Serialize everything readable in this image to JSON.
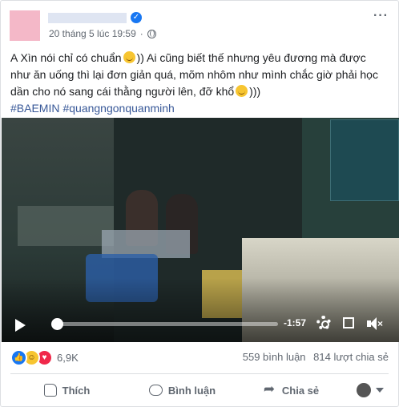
{
  "post": {
    "timestamp": "20 tháng 5 lúc 19:59",
    "separator": "·",
    "more_icon": "more-horizontal-icon",
    "text_line1_a": "A Xìn nói chỉ có chuẩn",
    "text_line1_b": ")) Ai cũng biết thế nhưng yêu đương mà được",
    "text_line2": "như ăn uống thì lại đơn giản quá, mõm nhôm như mình chắc giờ phải học",
    "text_line3_a": "dần cho nó sang cái thằng người lên, đỡ khổ",
    "text_line3_b": ")))",
    "hashtags": [
      "#BAEMIN",
      "#quangngonquanminh"
    ]
  },
  "video": {
    "time_remaining": "-1:57",
    "progress": 0.0,
    "controls": [
      "play-icon",
      "gear-icon",
      "expand-icon",
      "volume-muted-icon"
    ]
  },
  "stats": {
    "reaction_count": "6,9K",
    "comments": "559 bình luận",
    "shares": "814 lượt chia sẻ",
    "reaction_types": [
      "like",
      "haha",
      "love"
    ]
  },
  "actions": {
    "like": "Thích",
    "comment": "Bình luận",
    "share": "Chia sẻ"
  },
  "colors": {
    "link": "#385898",
    "accent": "#1877f2",
    "muted": "#606770"
  }
}
